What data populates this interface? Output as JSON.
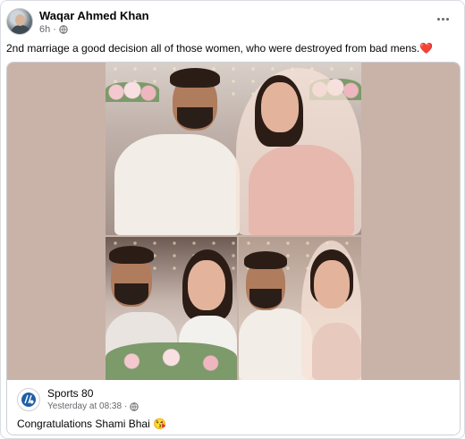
{
  "post": {
    "author": "Waqar Ahmed Khan",
    "time": "6h",
    "caption": "2nd marriage a good decision all of those women, who were destroyed from bad mens.",
    "caption_emoji": "❤️"
  },
  "shared_post": {
    "author": "Sports 80",
    "time": "Yesterday at 08:38",
    "text": "Congratulations Shami Bhai",
    "text_emoji": "😘"
  },
  "icons": [
    "globe-icon",
    "more-options-icon",
    "sports80-logo"
  ],
  "colors": {
    "photo_background": "#c9b3a8",
    "text_primary": "#050505",
    "text_secondary": "#65676b",
    "heart": "#e41e3f"
  }
}
